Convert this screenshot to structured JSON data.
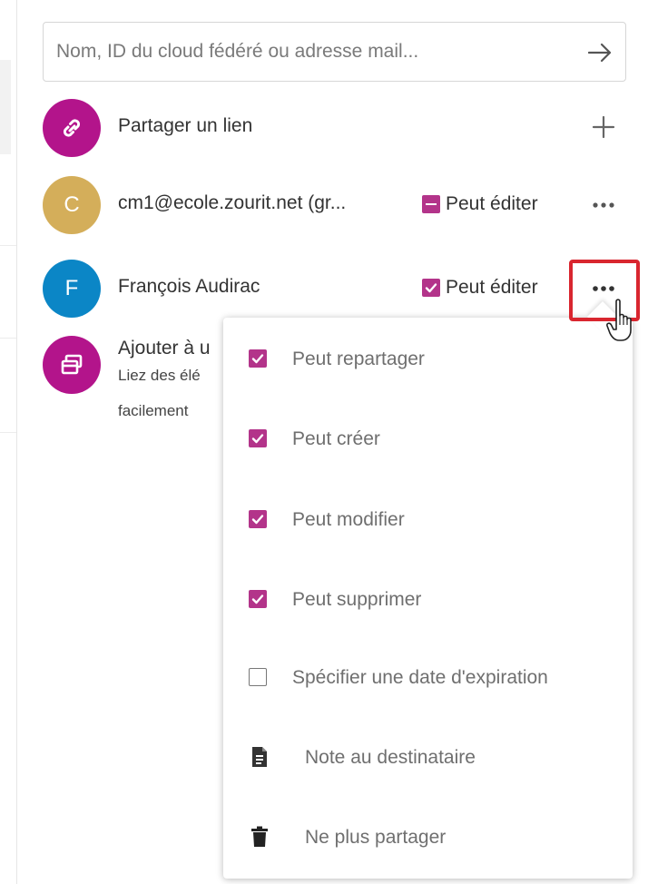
{
  "search": {
    "placeholder": "Nom, ID du cloud fédéré ou adresse mail...",
    "submit_icon": "arrow-right-icon"
  },
  "shares": [
    {
      "avatar_letter": "",
      "avatar_icon": "link-icon",
      "avatar_color": "#b3148b",
      "name": "Partager un lien",
      "action_icon": "plus-icon"
    },
    {
      "avatar_letter": "C",
      "avatar_color": "#d4ae5a",
      "name": "cm1@ecole.zourit.net (gr...",
      "permission_label": "Peut éditer",
      "permission_state": "indeterminate",
      "action_icon": "more-icon"
    },
    {
      "avatar_letter": "F",
      "avatar_color": "#0b86c6",
      "name": "François Audirac",
      "permission_label": "Peut éditer",
      "permission_state": "checked",
      "action_icon": "more-icon"
    }
  ],
  "collection": {
    "avatar_icon": "collection-icon",
    "avatar_color": "#b3148b",
    "title": "Ajouter à u",
    "description_line1": "Liez des élé",
    "description_line2": "facilement"
  },
  "menu": {
    "items": [
      {
        "label": "Peut repartager",
        "kind": "checkbox",
        "checked": true
      },
      {
        "label": "Peut créer",
        "kind": "checkbox",
        "checked": true
      },
      {
        "label": "Peut modifier",
        "kind": "checkbox",
        "checked": true
      },
      {
        "label": "Peut supprimer",
        "kind": "checkbox",
        "checked": true
      },
      {
        "label": "Spécifier une date d'expiration",
        "kind": "checkbox",
        "checked": false
      },
      {
        "label": "Note au destinataire",
        "kind": "icon",
        "icon": "note-icon"
      },
      {
        "label": "Ne plus partager",
        "kind": "icon",
        "icon": "trash-icon"
      }
    ]
  },
  "colors": {
    "accent": "#b3348a",
    "highlight": "#d9262f",
    "menu_text": "#6f6f6f"
  }
}
